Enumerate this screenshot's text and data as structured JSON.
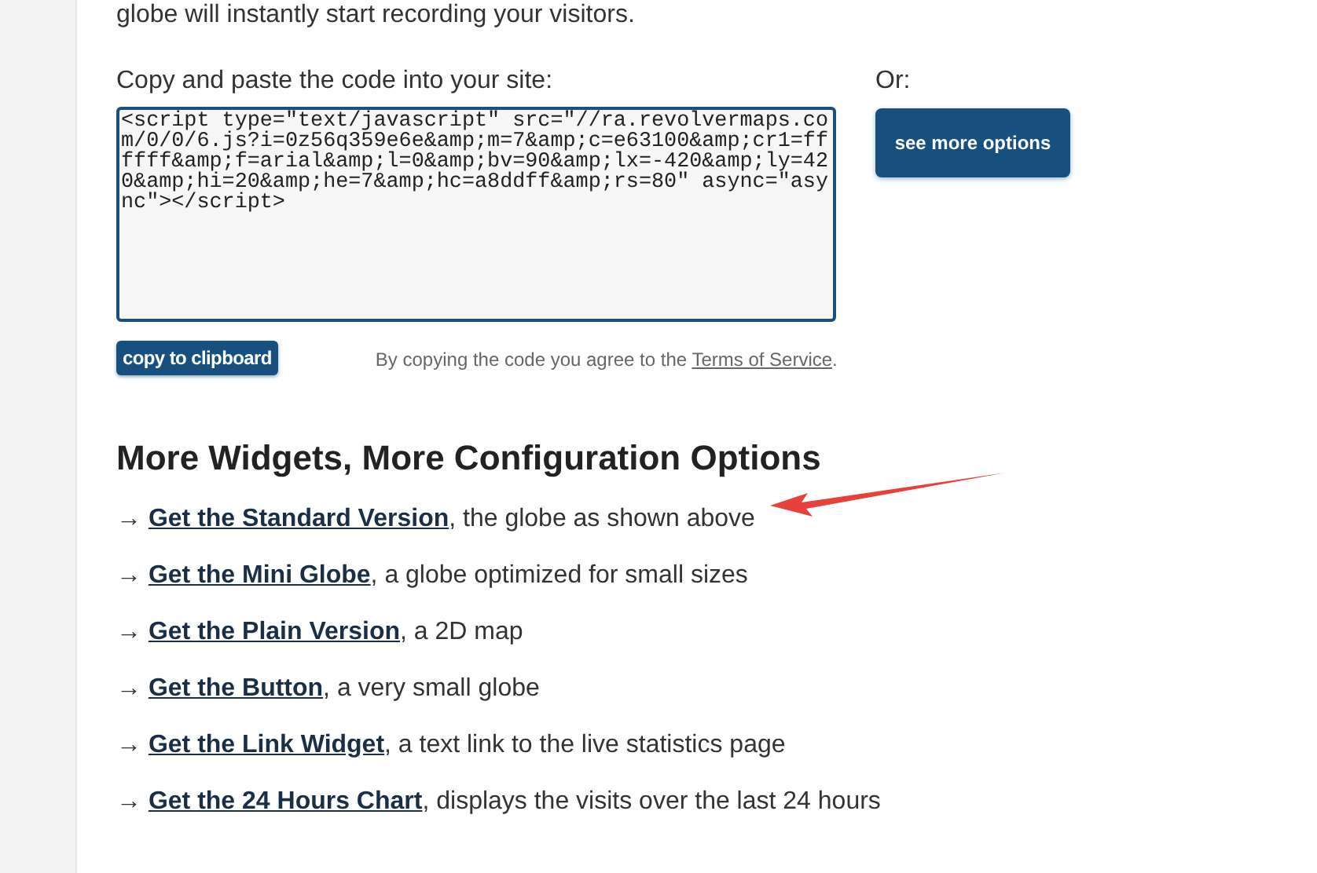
{
  "intro": "globe will instantly start recording your visitors.",
  "code_label": "Copy and paste the code into your site:",
  "code": "<script type=\"text/javascript\" src=\"//ra.revolvermaps.com/0/0/6.js?i=0z56q359e6e&amp;m=7&amp;c=e63100&amp;cr1=ffffff&amp;f=arial&amp;l=0&amp;bv=90&amp;lx=-420&amp;ly=420&amp;hi=20&amp;he=7&amp;hc=a8ddff&amp;rs=80\" async=\"async\"></script>",
  "or_label": "Or:",
  "more_button": "see more options",
  "copy_button": "copy to clipboard",
  "terms": {
    "text": "By copying the code you agree to the ",
    "link": "Terms of Service",
    "end": "."
  },
  "heading": "More Widgets, More Configuration Options",
  "widgets": [
    {
      "marker": "→",
      "link": "Get the Standard Version",
      "text": ", the globe as shown above",
      "highlighted": true
    },
    {
      "marker": "→",
      "link": "Get the Mini Globe",
      "text": ", a globe optimized for small sizes",
      "highlighted": false
    },
    {
      "marker": "→",
      "link": "Get the Plain Version",
      "text": ", a 2D map",
      "highlighted": false
    },
    {
      "marker": "→",
      "link": "Get the Button",
      "text": ", a very small globe",
      "highlighted": false
    },
    {
      "marker": "→",
      "link": "Get the Link Widget",
      "text": ", a text link to the live statistics page",
      "highlighted": false
    },
    {
      "marker": "→",
      "link": "Get the 24 Hours Chart",
      "text": ", displays the visits over the last 24 hours",
      "highlighted": false
    }
  ]
}
